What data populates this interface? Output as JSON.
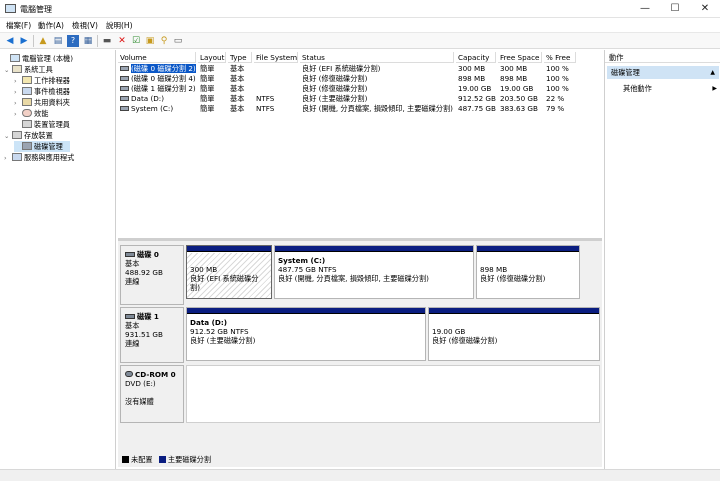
{
  "window": {
    "title": "電腦管理",
    "minimize": "—",
    "maximize": "☐",
    "close": "✕"
  },
  "menu": [
    "檔案(F)",
    "動作(A)",
    "檢視(V)",
    "說明(H)"
  ],
  "tree": [
    {
      "label": "電腦管理 (本機)",
      "level": 0,
      "chev": "",
      "selected": false
    },
    {
      "label": "系統工具",
      "level": 1,
      "chev": "⌄",
      "selected": false
    },
    {
      "label": "工作排程器",
      "level": 2,
      "chev": "›",
      "selected": false
    },
    {
      "label": "事件檢視器",
      "level": 2,
      "chev": "›",
      "selected": false
    },
    {
      "label": "共用資料夾",
      "level": 2,
      "chev": "›",
      "selected": false
    },
    {
      "label": "效能",
      "level": 2,
      "chev": "›",
      "selected": false
    },
    {
      "label": "裝置管理員",
      "level": 2,
      "chev": "",
      "selected": false
    },
    {
      "label": "存放裝置",
      "level": 1,
      "chev": "⌄",
      "selected": false
    },
    {
      "label": "磁碟管理",
      "level": 2,
      "chev": "",
      "selected": true
    },
    {
      "label": "服務與應用程式",
      "level": 1,
      "chev": "›",
      "selected": false
    }
  ],
  "volume_table": {
    "headers": [
      "Volume",
      "Layout",
      "Type",
      "File System",
      "Status",
      "Capacity",
      "Free Space",
      "% Free"
    ],
    "rows": [
      [
        "(磁碟 0 磁碟分割 2)",
        "簡單",
        "基本",
        "",
        "良好 (EFI 系統磁碟分割)",
        "300 MB",
        "300 MB",
        "100 %"
      ],
      [
        "(磁碟 0 磁碟分割 4)",
        "簡單",
        "基本",
        "",
        "良好 (修復磁碟分割)",
        "898 MB",
        "898 MB",
        "100 %"
      ],
      [
        "(磁碟 1 磁碟分割 2)",
        "簡單",
        "基本",
        "",
        "良好 (修復磁碟分割)",
        "19.00 GB",
        "19.00 GB",
        "100 %"
      ],
      [
        "Data (D:)",
        "簡單",
        "基本",
        "NTFS",
        "良好 (主要磁碟分割)",
        "912.52 GB",
        "203.50 GB",
        "22 %"
      ],
      [
        "System (C:)",
        "簡單",
        "基本",
        "NTFS",
        "良好 (開機, 分頁檔案, 損毀傾印, 主要磁碟分割)",
        "487.75 GB",
        "383.63 GB",
        "79 %"
      ]
    ]
  },
  "disks": [
    {
      "name": "磁碟 0",
      "type": "基本",
      "size": "488.92 GB",
      "state": "連線",
      "partitions": [
        {
          "name": "",
          "size": "300 MB",
          "status": "良好 (EFI 系統磁碟分割)"
        },
        {
          "name": "System  (C:)",
          "size": "487.75 GB NTFS",
          "status": "良好 (開機, 分頁檔案, 損毀傾印, 主要磁碟分割)"
        },
        {
          "name": "",
          "size": "898 MB",
          "status": "良好 (修復磁碟分割)"
        }
      ]
    },
    {
      "name": "磁碟 1",
      "type": "基本",
      "size": "931.51 GB",
      "state": "連線",
      "partitions": [
        {
          "name": "Data  (D:)",
          "size": "912.52 GB NTFS",
          "status": "良好 (主要磁碟分割)"
        },
        {
          "name": "",
          "size": "19.00 GB",
          "status": "良好 (修復磁碟分割)"
        }
      ]
    },
    {
      "name": "CD-ROM 0",
      "type": "DVD (E:)",
      "size": "",
      "state": "沒有媒體",
      "partitions": []
    }
  ],
  "legend": [
    {
      "label": "未配置",
      "color": "#000000"
    },
    {
      "label": "主要磁碟分割",
      "color": "#0a1d80"
    }
  ],
  "actions": {
    "title": "動作",
    "section": "磁碟管理",
    "section_arrow": "▲",
    "item": "其他動作",
    "item_arrow": "▶"
  },
  "colors": {
    "partition_bar": "#0a1d80",
    "selected_bg": "#cce4f7",
    "section_bg": "#cfe3f5"
  }
}
